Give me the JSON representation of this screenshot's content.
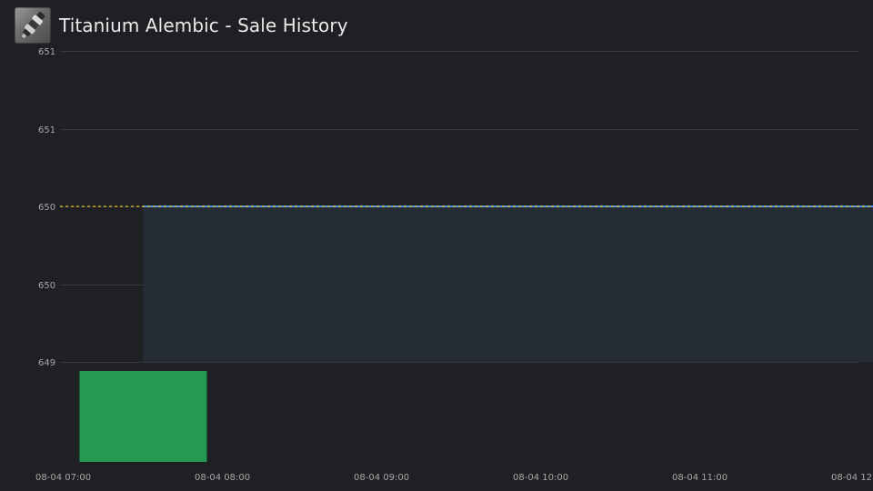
{
  "header": {
    "title": "Titanium Alembic - Sale History",
    "icon": "titanium-alembic-item-icon"
  },
  "colors": {
    "background": "#1f2023",
    "gridline": "#38393d",
    "price_line": "#4a90e2",
    "price_area": "#252c36",
    "average_line": "#e5c32a",
    "volume_bar": "#239a4f",
    "tick_text": "#a8a8a8"
  },
  "chart_data": {
    "type": "line",
    "title": "Titanium Alembic - Sale History",
    "xlabel": "",
    "ylabel": "",
    "y_tick_labels": [
      "651",
      "651",
      "650",
      "650",
      "649"
    ],
    "y_tick_values": [
      650.8,
      650.4,
      650.0,
      649.6,
      649.2
    ],
    "ylim": [
      649.2,
      650.8
    ],
    "x_tick_labels": [
      "08-04 07:00",
      "08-04 08:00",
      "08-04 09:00",
      "08-04 10:00",
      "08-04 11:00",
      "08-04 12:00"
    ],
    "x_tick_hours": [
      7,
      8,
      9,
      10,
      11,
      12
    ],
    "xlim_hours": [
      7,
      12.25
    ],
    "grid": true,
    "series": [
      {
        "kind": "price-area",
        "x_hours": [
          7.5,
          12.25
        ],
        "values": [
          650.0,
          650.0
        ]
      },
      {
        "kind": "average-dashed",
        "x_hours": [
          7,
          12.25
        ],
        "values": [
          650.0,
          650.0
        ]
      },
      {
        "kind": "volume-bar",
        "x_start_hours": 7.1,
        "x_end_hours": 7.9,
        "value": 1
      }
    ]
  }
}
